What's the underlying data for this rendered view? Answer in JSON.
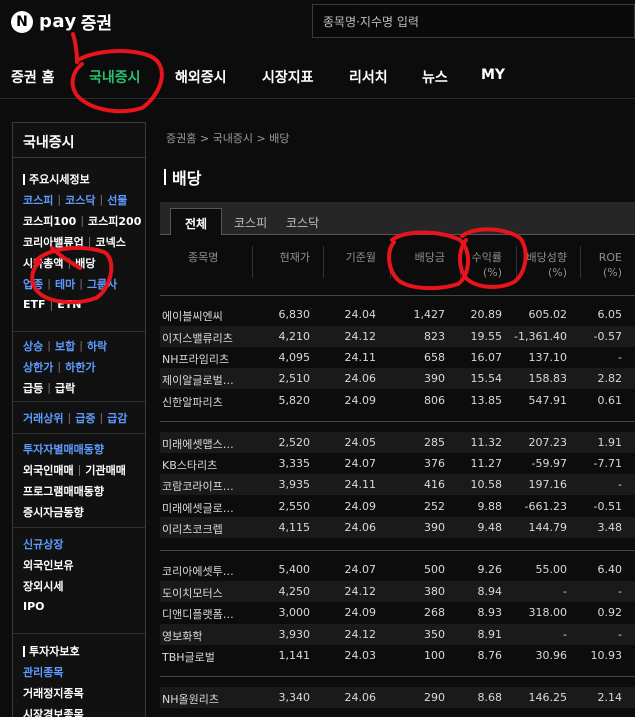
{
  "header": {
    "logo_n": "N",
    "logo_text": "pay",
    "logo_sub": "증권",
    "search_placeholder": "종목명·지수명 입력"
  },
  "gnb": {
    "items": [
      "증권 홈",
      "국내증시",
      "해외증시",
      "시장지표",
      "리서치",
      "뉴스",
      "MY"
    ],
    "active": "국내증시"
  },
  "sidebar": {
    "title": "국내증시",
    "group1_title": "주요시세정보",
    "rows1": [
      {
        "items": [
          "코스피",
          "코스닥",
          "선물"
        ],
        "blue": true
      },
      {
        "items": [
          "코스피100",
          "코스피200"
        ],
        "blue": false
      },
      {
        "items": [
          "코리아밸류업",
          "코넥스"
        ],
        "blue": false
      },
      {
        "items": [
          "시가총액",
          "배당"
        ],
        "blue": false
      },
      {
        "items": [
          "업종",
          "테마",
          "그룹사"
        ],
        "blue": true
      },
      {
        "items": [
          "ETF",
          "ETN"
        ],
        "blue": false
      }
    ],
    "rows2": [
      {
        "items": [
          "상승",
          "보합",
          "하락"
        ],
        "blue": true
      },
      {
        "items": [
          "상한가",
          "하한가"
        ],
        "blue": true
      },
      {
        "items": [
          "급등",
          "급락"
        ],
        "blue": false
      }
    ],
    "rows3": [
      {
        "items": [
          "거래상위",
          "급증",
          "급감"
        ],
        "blue": true
      }
    ],
    "rows4": [
      {
        "items": [
          "투자자별매매동향"
        ],
        "blue": true
      },
      {
        "items": [
          "외국인매매",
          "기관매매"
        ],
        "blue": false
      },
      {
        "items": [
          "프로그램매매동향"
        ],
        "blue": false
      },
      {
        "items": [
          "증시자금동향"
        ],
        "blue": false
      }
    ],
    "rows5": [
      {
        "items": [
          "신규상장"
        ],
        "blue": true
      },
      {
        "items": [
          "외국인보유"
        ],
        "blue": false
      },
      {
        "items": [
          "장외시세"
        ],
        "blue": false
      },
      {
        "items": [
          "IPO"
        ],
        "blue": false
      }
    ],
    "group2_title": "투자자보호",
    "rows6": [
      {
        "items": [
          "관리종목"
        ],
        "blue": true
      },
      {
        "items": [
          "거래정지종목"
        ],
        "blue": false
      },
      {
        "items": [
          "시장경보종목"
        ],
        "blue": false
      }
    ]
  },
  "main": {
    "breadcrumb": "증권홈 > 국내증시 > 배당",
    "title": "배당",
    "tabs": [
      "전체",
      "코스피",
      "코스닥"
    ],
    "active_tab": "전체",
    "columns": [
      {
        "line1": "종목명",
        "line2": ""
      },
      {
        "line1": "현재가",
        "line2": ""
      },
      {
        "line1": "기준월",
        "line2": ""
      },
      {
        "line1": "배당금",
        "line2": ""
      },
      {
        "line1": "수익률",
        "line2": "(%)"
      },
      {
        "line1": "배당성향",
        "line2": "(%)"
      },
      {
        "line1": "ROE",
        "line2": "(%)"
      }
    ],
    "rows": [
      [
        "에이블씨엔씨",
        "6,830",
        "24.04",
        "1,427",
        "20.89",
        "605.02",
        "6.05"
      ],
      [
        "이지스밸류리츠",
        "4,210",
        "24.12",
        "823",
        "19.55",
        "-1,361.40",
        "-0.57"
      ],
      [
        "NH프라임리츠",
        "4,095",
        "24.11",
        "658",
        "16.07",
        "137.10",
        "-"
      ],
      [
        "제이알글로벌…",
        "2,510",
        "24.06",
        "390",
        "15.54",
        "158.83",
        "2.82"
      ],
      [
        "신한알파리츠",
        "5,820",
        "24.09",
        "806",
        "13.85",
        "547.91",
        "0.61"
      ],
      [
        "미래에셋맵스…",
        "2,520",
        "24.05",
        "285",
        "11.32",
        "207.23",
        "1.91"
      ],
      [
        "KB스타리츠",
        "3,335",
        "24.07",
        "376",
        "11.27",
        "-59.97",
        "-7.71"
      ],
      [
        "코람코라이프…",
        "3,935",
        "24.11",
        "416",
        "10.58",
        "197.16",
        "-"
      ],
      [
        "미래에셋글로…",
        "2,550",
        "24.09",
        "252",
        "9.88",
        "-661.23",
        "-0.51"
      ],
      [
        "이리츠코크렙",
        "4,115",
        "24.06",
        "390",
        "9.48",
        "144.79",
        "3.48"
      ],
      [
        "코리아에셋투…",
        "5,400",
        "24.07",
        "500",
        "9.26",
        "55.00",
        "6.40"
      ],
      [
        "도이치모터스",
        "4,250",
        "24.12",
        "380",
        "8.94",
        "-",
        "-"
      ],
      [
        "디앤디플랫폼…",
        "3,000",
        "24.09",
        "268",
        "8.93",
        "318.00",
        "0.92"
      ],
      [
        "영보화학",
        "3,930",
        "24.12",
        "350",
        "8.91",
        "-",
        "-"
      ],
      [
        "TBH글로벌",
        "1,141",
        "24.03",
        "100",
        "8.76",
        "30.96",
        "10.93"
      ],
      [
        "NH올원리츠",
        "3,340",
        "24.06",
        "290",
        "8.68",
        "146.25",
        "2.14"
      ]
    ]
  },
  "colors": {
    "accent_green": "#25c16f",
    "link_blue": "#5f9bff",
    "annotation_red": "#e8141b"
  }
}
